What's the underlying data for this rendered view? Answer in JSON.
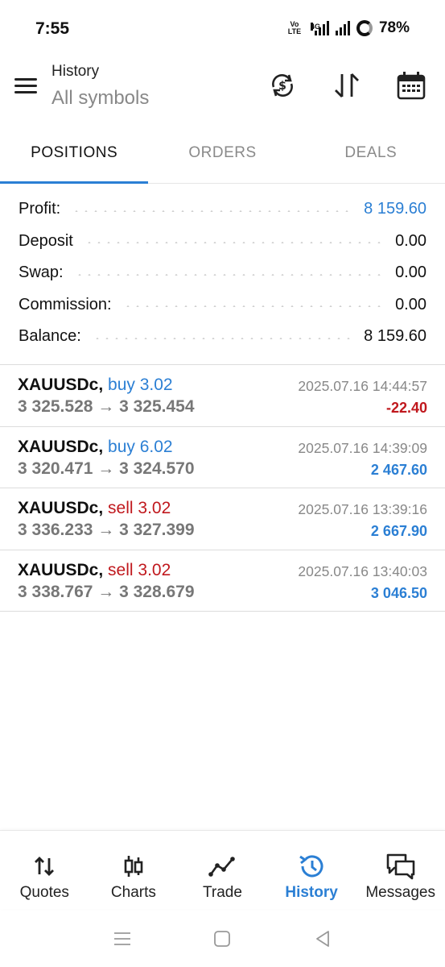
{
  "status_bar": {
    "time": "7:55",
    "volte_top": "Vo",
    "volte_bottom": "LTE",
    "network": "4G",
    "battery": "78%"
  },
  "header": {
    "title": "History",
    "subtitle": "All symbols",
    "icons": [
      "currency-refresh-icon",
      "sort-icon",
      "calendar-icon"
    ]
  },
  "tabs": [
    {
      "label": "POSITIONS",
      "active": true
    },
    {
      "label": "ORDERS",
      "active": false
    },
    {
      "label": "DEALS",
      "active": false
    }
  ],
  "summary": {
    "profit": {
      "label": "Profit:",
      "value": "8 159.60"
    },
    "deposit": {
      "label": "Deposit",
      "value": "0.00"
    },
    "swap": {
      "label": "Swap:",
      "value": "0.00"
    },
    "commission": {
      "label": "Commission:",
      "value": "0.00"
    },
    "balance": {
      "label": "Balance:",
      "value": "8 159.60"
    }
  },
  "positions": [
    {
      "symbol": "XAUUSDc,",
      "type": "buy 3.02",
      "prices": "3 325.528 → 3 325.454",
      "time": "2025.07.16 14:44:57",
      "profit": "-22.40"
    },
    {
      "symbol": "XAUUSDc,",
      "type": "buy 6.02",
      "prices": "3 320.471 → 3 324.570",
      "time": "2025.07.16 14:39:09",
      "profit": "2 467.60"
    },
    {
      "symbol": "XAUUSDc,",
      "type": "sell 3.02",
      "prices": "3 336.233 → 3 327.399",
      "time": "2025.07.16 13:39:16",
      "profit": "2 667.90"
    },
    {
      "symbol": "XAUUSDc,",
      "type": "sell 3.02",
      "prices": "3 338.767 → 3 328.679",
      "time": "2025.07.16 13:40:03",
      "profit": "3 046.50"
    }
  ],
  "bottom_nav": [
    {
      "label": "Quotes",
      "icon": "quotes-icon",
      "active": false
    },
    {
      "label": "Charts",
      "icon": "candlestick-icon",
      "active": false
    },
    {
      "label": "Trade",
      "icon": "trade-line-icon",
      "active": false
    },
    {
      "label": "History",
      "icon": "history-clock-icon",
      "active": true
    },
    {
      "label": "Messages",
      "icon": "messages-icon",
      "active": false
    }
  ],
  "colors": {
    "accent_blue": "#2b7fd4",
    "loss_red": "#c0181d",
    "muted_gray": "#888888"
  }
}
